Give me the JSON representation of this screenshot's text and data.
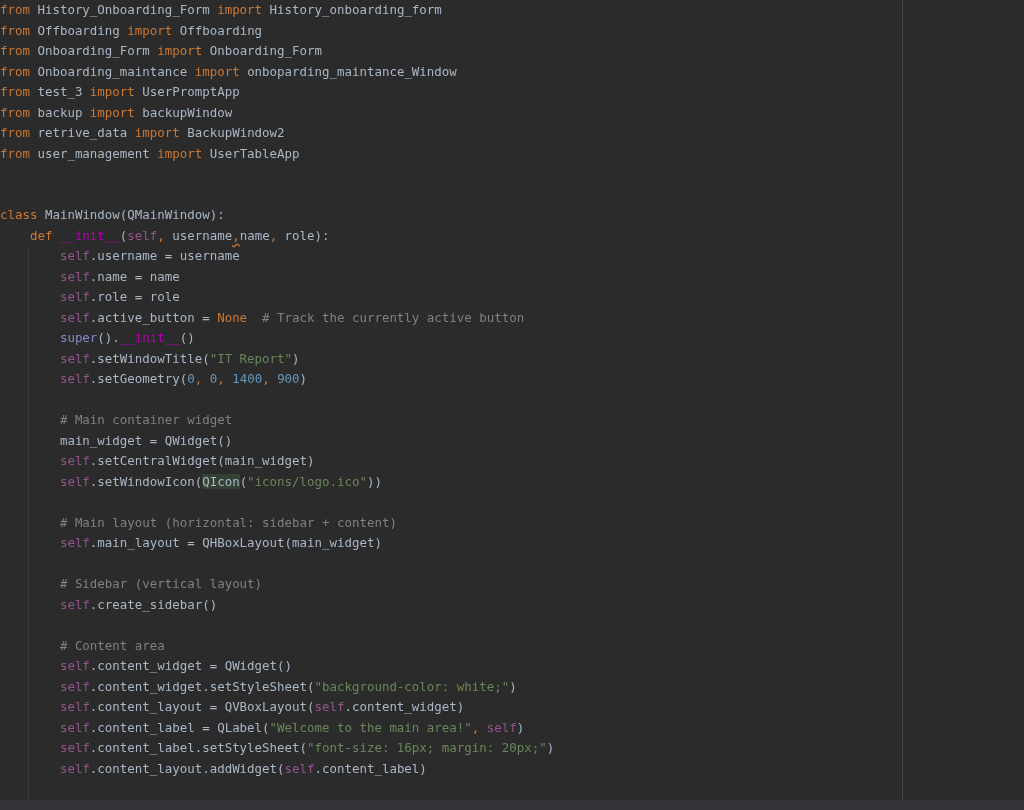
{
  "editor": {
    "lines": [
      {
        "kind": "code",
        "tokens": [
          {
            "kind": "keyword",
            "text": "from"
          },
          {
            "kind": "plain",
            "text": " History_Onboarding_Form "
          },
          {
            "kind": "keyword",
            "text": "import"
          },
          {
            "kind": "plain",
            "text": " History_onboarding_form"
          }
        ]
      },
      {
        "kind": "code",
        "tokens": [
          {
            "kind": "keyword",
            "text": "from"
          },
          {
            "kind": "plain",
            "text": " Offboarding "
          },
          {
            "kind": "keyword",
            "text": "import"
          },
          {
            "kind": "plain",
            "text": " Offboarding"
          }
        ]
      },
      {
        "kind": "code",
        "tokens": [
          {
            "kind": "keyword",
            "text": "from"
          },
          {
            "kind": "plain",
            "text": " Onboarding_Form "
          },
          {
            "kind": "keyword",
            "text": "import"
          },
          {
            "kind": "plain",
            "text": " Onboarding_Form"
          }
        ]
      },
      {
        "kind": "code",
        "tokens": [
          {
            "kind": "keyword",
            "text": "from"
          },
          {
            "kind": "plain",
            "text": " Onboarding_maintance "
          },
          {
            "kind": "keyword",
            "text": "import"
          },
          {
            "kind": "plain",
            "text": " onboparding_maintance_Window"
          }
        ]
      },
      {
        "kind": "code",
        "tokens": [
          {
            "kind": "keyword",
            "text": "from"
          },
          {
            "kind": "plain",
            "text": " test_3 "
          },
          {
            "kind": "keyword",
            "text": "import"
          },
          {
            "kind": "plain",
            "text": " UserPromptApp"
          }
        ]
      },
      {
        "kind": "code",
        "tokens": [
          {
            "kind": "keyword",
            "text": "from"
          },
          {
            "kind": "plain",
            "text": " backup "
          },
          {
            "kind": "keyword",
            "text": "import"
          },
          {
            "kind": "plain",
            "text": " backupWindow"
          }
        ]
      },
      {
        "kind": "code",
        "tokens": [
          {
            "kind": "keyword",
            "text": "from"
          },
          {
            "kind": "plain",
            "text": " retrive_data "
          },
          {
            "kind": "keyword",
            "text": "import"
          },
          {
            "kind": "plain",
            "text": " BackupWindow2"
          }
        ]
      },
      {
        "kind": "code",
        "tokens": [
          {
            "kind": "keyword",
            "text": "from"
          },
          {
            "kind": "plain",
            "text": " user_management "
          },
          {
            "kind": "keyword",
            "text": "import"
          },
          {
            "kind": "plain",
            "text": " UserTableApp"
          }
        ]
      },
      {
        "kind": "blank"
      },
      {
        "kind": "blank"
      },
      {
        "kind": "code",
        "tokens": [
          {
            "kind": "keyword",
            "text": "class"
          },
          {
            "kind": "plain",
            "text": " MainWindow(QMainWindow):"
          }
        ]
      },
      {
        "kind": "code",
        "tokens": [
          {
            "kind": "keyword",
            "text": "    def "
          },
          {
            "kind": "dunder",
            "text": "__init__"
          },
          {
            "kind": "plain",
            "text": "("
          },
          {
            "kind": "self",
            "text": "self"
          },
          {
            "kind": "punct",
            "text": ","
          },
          {
            "kind": "plain",
            "text": " username"
          },
          {
            "kind": "warning",
            "text": ","
          },
          {
            "kind": "plain",
            "text": "name"
          },
          {
            "kind": "punct",
            "text": ","
          },
          {
            "kind": "plain",
            "text": " role):"
          }
        ]
      },
      {
        "kind": "code",
        "tokens": [
          {
            "kind": "self",
            "text": "        self"
          },
          {
            "kind": "plain",
            "text": ".username = username"
          }
        ]
      },
      {
        "kind": "code",
        "tokens": [
          {
            "kind": "self",
            "text": "        self"
          },
          {
            "kind": "plain",
            "text": ".name = name"
          }
        ]
      },
      {
        "kind": "code",
        "tokens": [
          {
            "kind": "self",
            "text": "        self"
          },
          {
            "kind": "plain",
            "text": ".role = role"
          }
        ]
      },
      {
        "kind": "code",
        "tokens": [
          {
            "kind": "self",
            "text": "        self"
          },
          {
            "kind": "plain",
            "text": ".active_button = "
          },
          {
            "kind": "keyword",
            "text": "None"
          },
          {
            "kind": "comment",
            "text": "  # Track the currently active button"
          }
        ]
      },
      {
        "kind": "code",
        "tokens": [
          {
            "kind": "builtin",
            "text": "        super"
          },
          {
            "kind": "plain",
            "text": "()."
          },
          {
            "kind": "dunder",
            "text": "__init__"
          },
          {
            "kind": "plain",
            "text": "()"
          }
        ]
      },
      {
        "kind": "code",
        "tokens": [
          {
            "kind": "self",
            "text": "        self"
          },
          {
            "kind": "plain",
            "text": ".setWindowTitle("
          },
          {
            "kind": "string",
            "text": "\"IT Report\""
          },
          {
            "kind": "plain",
            "text": ")"
          }
        ]
      },
      {
        "kind": "code",
        "tokens": [
          {
            "kind": "self",
            "text": "        self"
          },
          {
            "kind": "plain",
            "text": ".setGeometry("
          },
          {
            "kind": "number",
            "text": "0"
          },
          {
            "kind": "punct",
            "text": ", "
          },
          {
            "kind": "number",
            "text": "0"
          },
          {
            "kind": "punct",
            "text": ", "
          },
          {
            "kind": "number",
            "text": "1400"
          },
          {
            "kind": "punct",
            "text": ", "
          },
          {
            "kind": "number",
            "text": "900"
          },
          {
            "kind": "plain",
            "text": ")"
          }
        ]
      },
      {
        "kind": "blank"
      },
      {
        "kind": "code",
        "tokens": [
          {
            "kind": "comment",
            "text": "        # Main container widget"
          }
        ]
      },
      {
        "kind": "code",
        "tokens": [
          {
            "kind": "plain",
            "text": "        main_widget = QWidget()"
          }
        ]
      },
      {
        "kind": "code",
        "tokens": [
          {
            "kind": "self",
            "text": "        self"
          },
          {
            "kind": "plain",
            "text": ".setCentralWidget(main_widget)"
          }
        ]
      },
      {
        "kind": "code",
        "tokens": [
          {
            "kind": "self",
            "text": "        self"
          },
          {
            "kind": "plain",
            "text": ".setWindowIcon("
          },
          {
            "kind": "highlight",
            "text": "QIcon"
          },
          {
            "kind": "plain",
            "text": "("
          },
          {
            "kind": "string",
            "text": "\"icons/logo.ico\""
          },
          {
            "kind": "plain",
            "text": "))"
          }
        ]
      },
      {
        "kind": "blank"
      },
      {
        "kind": "code",
        "tokens": [
          {
            "kind": "comment",
            "text": "        # Main layout (horizontal: sidebar + content)"
          }
        ]
      },
      {
        "kind": "code",
        "tokens": [
          {
            "kind": "self",
            "text": "        self"
          },
          {
            "kind": "plain",
            "text": ".main_layout = QHBoxLayout(main_widget)"
          }
        ]
      },
      {
        "kind": "blank"
      },
      {
        "kind": "code",
        "tokens": [
          {
            "kind": "comment",
            "text": "        # Sidebar (vertical layout)"
          }
        ]
      },
      {
        "kind": "code",
        "tokens": [
          {
            "kind": "self",
            "text": "        self"
          },
          {
            "kind": "plain",
            "text": ".create_sidebar()"
          }
        ]
      },
      {
        "kind": "blank"
      },
      {
        "kind": "code",
        "tokens": [
          {
            "kind": "comment",
            "text": "        # Content area"
          }
        ]
      },
      {
        "kind": "code",
        "tokens": [
          {
            "kind": "self",
            "text": "        self"
          },
          {
            "kind": "plain",
            "text": ".content_widget = QWidget()"
          }
        ]
      },
      {
        "kind": "code",
        "tokens": [
          {
            "kind": "self",
            "text": "        self"
          },
          {
            "kind": "plain",
            "text": ".content_widget.setStyleSheet("
          },
          {
            "kind": "string",
            "text": "\"background-color: white;\""
          },
          {
            "kind": "plain",
            "text": ")"
          }
        ]
      },
      {
        "kind": "code",
        "tokens": [
          {
            "kind": "self",
            "text": "        self"
          },
          {
            "kind": "plain",
            "text": ".content_layout = QVBoxLayout("
          },
          {
            "kind": "self",
            "text": "self"
          },
          {
            "kind": "plain",
            "text": ".content_widget)"
          }
        ]
      },
      {
        "kind": "code",
        "tokens": [
          {
            "kind": "self",
            "text": "        self"
          },
          {
            "kind": "plain",
            "text": ".content_label = QLabel("
          },
          {
            "kind": "string",
            "text": "\"Welcome to the main area!\""
          },
          {
            "kind": "punct",
            "text": ", "
          },
          {
            "kind": "self",
            "text": "self"
          },
          {
            "kind": "plain",
            "text": ")"
          }
        ]
      },
      {
        "kind": "code",
        "tokens": [
          {
            "kind": "self",
            "text": "        self"
          },
          {
            "kind": "plain",
            "text": ".content_label.setStyleSheet("
          },
          {
            "kind": "string",
            "text": "\"font-size: 16px; margin: 20px;\""
          },
          {
            "kind": "plain",
            "text": ")"
          }
        ]
      },
      {
        "kind": "code",
        "tokens": [
          {
            "kind": "self",
            "text": "        self"
          },
          {
            "kind": "plain",
            "text": ".content_layout.addWidget("
          },
          {
            "kind": "self",
            "text": "self"
          },
          {
            "kind": "plain",
            "text": ".content_label)"
          }
        ]
      }
    ]
  }
}
